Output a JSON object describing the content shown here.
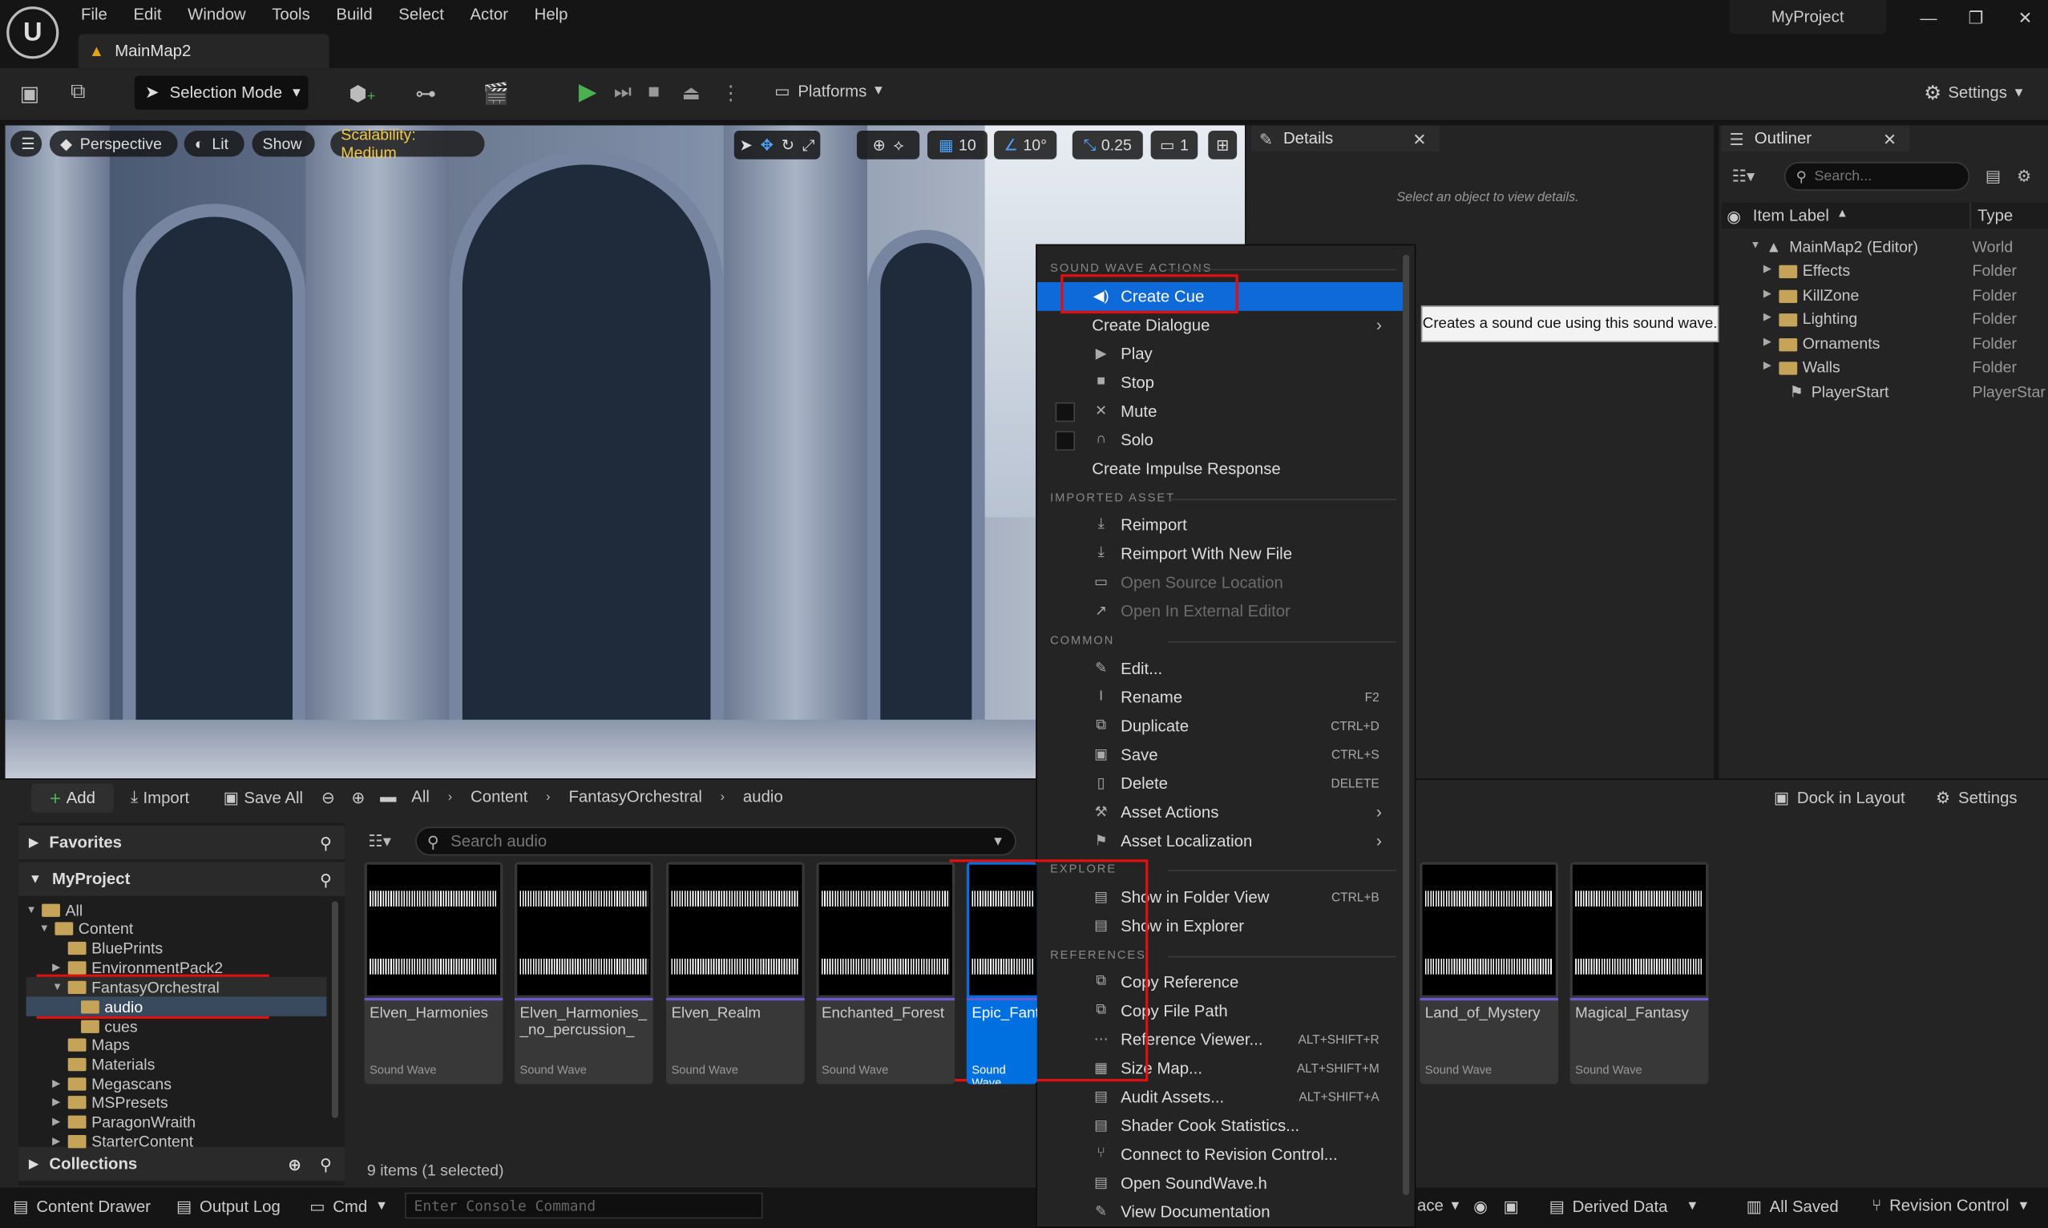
{
  "menu_bar": [
    "File",
    "Edit",
    "Window",
    "Tools",
    "Build",
    "Select",
    "Actor",
    "Help"
  ],
  "map_tab": "MainMap2",
  "project_name": "MyProject",
  "toolbar": {
    "selection_mode": "Selection Mode",
    "platforms": "Platforms",
    "settings": "Settings"
  },
  "viewport": {
    "perspective": "Perspective",
    "lit": "Lit",
    "show": "Show",
    "scalability": "Scalability: Medium",
    "grid_snap": "10",
    "rot_snap": "10°",
    "scale_snap": "0.25",
    "camera_speed": "1"
  },
  "details": {
    "title": "Details",
    "empty_hint": "Select an object to view details."
  },
  "outliner": {
    "title": "Outliner",
    "search_placeholder": "Search...",
    "col_label": "Item Label",
    "col_type": "Type",
    "rows": [
      {
        "label": "MainMap2 (Editor)",
        "type": "World"
      },
      {
        "label": "Effects",
        "type": "Folder"
      },
      {
        "label": "KillZone",
        "type": "Folder"
      },
      {
        "label": "Lighting",
        "type": "Folder"
      },
      {
        "label": "Ornaments",
        "type": "Folder"
      },
      {
        "label": "Walls",
        "type": "Folder"
      },
      {
        "label": "PlayerStart",
        "type": "PlayerStar"
      }
    ]
  },
  "content_browser": {
    "add": "Add",
    "import": "Import",
    "save_all": "Save All",
    "breadcrumbs": [
      "All",
      "Content",
      "FantasyOrchestral",
      "audio"
    ],
    "dock_in_layout": "Dock in Layout",
    "settings": "Settings",
    "favorites": "Favorites",
    "project": "MyProject",
    "collections": "Collections",
    "search_placeholder": "Search audio",
    "tree": [
      {
        "label": "All",
        "indent": 0
      },
      {
        "label": "Content",
        "indent": 1
      },
      {
        "label": "BluePrints",
        "indent": 2
      },
      {
        "label": "EnvironmentPack2",
        "indent": 2
      },
      {
        "label": "FantasyOrchestral",
        "indent": 2
      },
      {
        "label": "audio",
        "indent": 3
      },
      {
        "label": "cues",
        "indent": 3
      },
      {
        "label": "Maps",
        "indent": 2
      },
      {
        "label": "Materials",
        "indent": 2
      },
      {
        "label": "Megascans",
        "indent": 2
      },
      {
        "label": "MSPresets",
        "indent": 2
      },
      {
        "label": "ParagonWraith",
        "indent": 2
      },
      {
        "label": "StarterContent",
        "indent": 2
      }
    ],
    "assets": [
      {
        "name": "Elven_Harmonies",
        "type": "Sound Wave"
      },
      {
        "name": "Elven_Harmonies__no_percussion_",
        "type": "Sound Wave"
      },
      {
        "name": "Elven_Realm",
        "type": "Sound Wave"
      },
      {
        "name": "Enchanted_Forest",
        "type": "Sound Wave"
      },
      {
        "name": "Epic_Fanta",
        "type": "Sound Wave"
      },
      {
        "name": "Land_of_Mystery",
        "type": "Sound Wave"
      },
      {
        "name": "Magical_Fantasy",
        "type": "Sound Wave"
      }
    ],
    "item_count": "9 items (1 selected)"
  },
  "context_menu": {
    "sections": [
      {
        "title": "SOUND WAVE ACTIONS",
        "items": [
          {
            "label": "Create Cue",
            "icon": "sound-cue-icon",
            "highlight": true
          },
          {
            "label": "Create Dialogue",
            "submenu": true,
            "noicon": true
          },
          {
            "label": "Play",
            "icon": "play-icon"
          },
          {
            "label": "Stop",
            "icon": "stop-icon"
          },
          {
            "label": "Mute",
            "icon": "mute-icon",
            "check": true
          },
          {
            "label": "Solo",
            "icon": "headphones-icon",
            "check": true
          },
          {
            "label": "Create Impulse Response",
            "noicon": true
          }
        ]
      },
      {
        "title": "IMPORTED ASSET",
        "items": [
          {
            "label": "Reimport",
            "icon": "reimport-icon"
          },
          {
            "label": "Reimport With New File",
            "icon": "reimport-icon"
          },
          {
            "label": "Open Source Location",
            "icon": "folder-icon",
            "disabled": true
          },
          {
            "label": "Open In External Editor",
            "icon": "external-icon",
            "disabled": true
          }
        ]
      },
      {
        "title": "COMMON",
        "items": [
          {
            "label": "Edit...",
            "icon": "pencil-icon"
          },
          {
            "label": "Rename",
            "icon": "rename-icon",
            "shortcut": "F2"
          },
          {
            "label": "Duplicate",
            "icon": "duplicate-icon",
            "shortcut": "CTRL+D"
          },
          {
            "label": "Save",
            "icon": "save-icon",
            "shortcut": "CTRL+S"
          },
          {
            "label": "Delete",
            "icon": "trash-icon",
            "shortcut": "DELETE"
          },
          {
            "label": "Asset Actions",
            "icon": "wrench-icon",
            "submenu": true
          },
          {
            "label": "Asset Localization",
            "icon": "flag-icon",
            "submenu": true
          }
        ]
      },
      {
        "title": "EXPLORE",
        "items": [
          {
            "label": "Show in Folder View",
            "icon": "folder-view-icon",
            "shortcut": "CTRL+B"
          },
          {
            "label": "Show in Explorer",
            "icon": "explorer-icon"
          }
        ]
      },
      {
        "title": "REFERENCES",
        "items": [
          {
            "label": "Copy Reference",
            "icon": "copy-icon"
          },
          {
            "label": "Copy File Path",
            "icon": "copy-icon"
          },
          {
            "label": "Reference Viewer...",
            "icon": "graph-icon",
            "shortcut": "ALT+SHIFT+R"
          },
          {
            "label": "Size Map...",
            "icon": "sizemap-icon",
            "shortcut": "ALT+SHIFT+M"
          },
          {
            "label": "Audit Assets...",
            "icon": "audit-icon",
            "shortcut": "ALT+SHIFT+A"
          },
          {
            "label": "Shader Cook Statistics...",
            "icon": "stats-icon"
          },
          {
            "label": "Connect to Revision Control...",
            "icon": "revision-icon"
          },
          {
            "label": "Open SoundWave.h",
            "icon": "code-icon"
          },
          {
            "label": "View Documentation",
            "icon": "doc-icon"
          }
        ]
      }
    ]
  },
  "tooltip": "Creates a sound cue using this sound wave.",
  "status_bar": {
    "content_drawer": "Content Drawer",
    "output_log": "Output Log",
    "cmd": "Cmd",
    "console_placeholder": "Enter Console Command",
    "ace": "ace",
    "derived_data": "Derived Data",
    "all_saved": "All Saved",
    "revision_control": "Revision Control"
  },
  "colors": {
    "accent": "#0e6ad8",
    "highlight_box": "#e01010",
    "folder": "#c5a45a",
    "play": "#4caf50",
    "scalability": "#f2c94c"
  }
}
